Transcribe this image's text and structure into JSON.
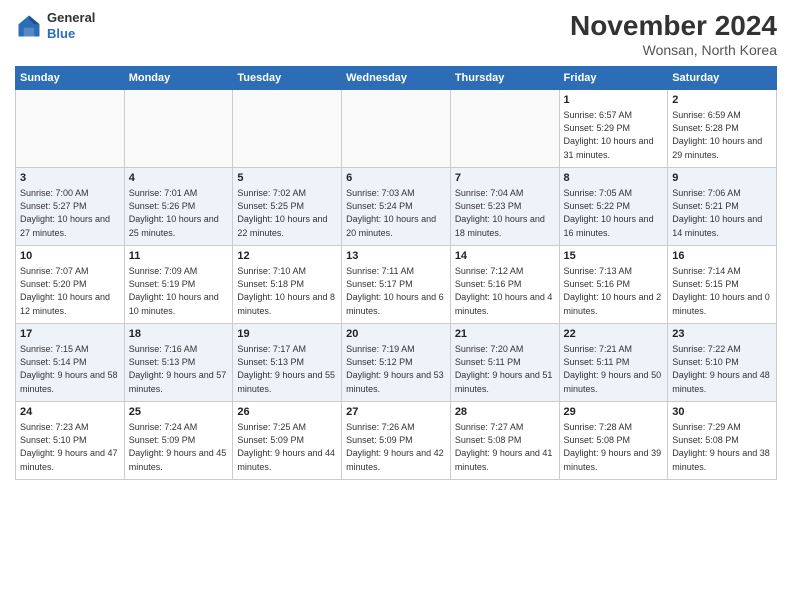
{
  "logo": {
    "line1": "General",
    "line2": "Blue"
  },
  "title": "November 2024",
  "location": "Wonsan, North Korea",
  "days_header": [
    "Sunday",
    "Monday",
    "Tuesday",
    "Wednesday",
    "Thursday",
    "Friday",
    "Saturday"
  ],
  "weeks": [
    [
      {
        "day": "",
        "info": ""
      },
      {
        "day": "",
        "info": ""
      },
      {
        "day": "",
        "info": ""
      },
      {
        "day": "",
        "info": ""
      },
      {
        "day": "",
        "info": ""
      },
      {
        "day": "1",
        "info": "Sunrise: 6:57 AM\nSunset: 5:29 PM\nDaylight: 10 hours and 31 minutes."
      },
      {
        "day": "2",
        "info": "Sunrise: 6:59 AM\nSunset: 5:28 PM\nDaylight: 10 hours and 29 minutes."
      }
    ],
    [
      {
        "day": "3",
        "info": "Sunrise: 7:00 AM\nSunset: 5:27 PM\nDaylight: 10 hours and 27 minutes."
      },
      {
        "day": "4",
        "info": "Sunrise: 7:01 AM\nSunset: 5:26 PM\nDaylight: 10 hours and 25 minutes."
      },
      {
        "day": "5",
        "info": "Sunrise: 7:02 AM\nSunset: 5:25 PM\nDaylight: 10 hours and 22 minutes."
      },
      {
        "day": "6",
        "info": "Sunrise: 7:03 AM\nSunset: 5:24 PM\nDaylight: 10 hours and 20 minutes."
      },
      {
        "day": "7",
        "info": "Sunrise: 7:04 AM\nSunset: 5:23 PM\nDaylight: 10 hours and 18 minutes."
      },
      {
        "day": "8",
        "info": "Sunrise: 7:05 AM\nSunset: 5:22 PM\nDaylight: 10 hours and 16 minutes."
      },
      {
        "day": "9",
        "info": "Sunrise: 7:06 AM\nSunset: 5:21 PM\nDaylight: 10 hours and 14 minutes."
      }
    ],
    [
      {
        "day": "10",
        "info": "Sunrise: 7:07 AM\nSunset: 5:20 PM\nDaylight: 10 hours and 12 minutes."
      },
      {
        "day": "11",
        "info": "Sunrise: 7:09 AM\nSunset: 5:19 PM\nDaylight: 10 hours and 10 minutes."
      },
      {
        "day": "12",
        "info": "Sunrise: 7:10 AM\nSunset: 5:18 PM\nDaylight: 10 hours and 8 minutes."
      },
      {
        "day": "13",
        "info": "Sunrise: 7:11 AM\nSunset: 5:17 PM\nDaylight: 10 hours and 6 minutes."
      },
      {
        "day": "14",
        "info": "Sunrise: 7:12 AM\nSunset: 5:16 PM\nDaylight: 10 hours and 4 minutes."
      },
      {
        "day": "15",
        "info": "Sunrise: 7:13 AM\nSunset: 5:16 PM\nDaylight: 10 hours and 2 minutes."
      },
      {
        "day": "16",
        "info": "Sunrise: 7:14 AM\nSunset: 5:15 PM\nDaylight: 10 hours and 0 minutes."
      }
    ],
    [
      {
        "day": "17",
        "info": "Sunrise: 7:15 AM\nSunset: 5:14 PM\nDaylight: 9 hours and 58 minutes."
      },
      {
        "day": "18",
        "info": "Sunrise: 7:16 AM\nSunset: 5:13 PM\nDaylight: 9 hours and 57 minutes."
      },
      {
        "day": "19",
        "info": "Sunrise: 7:17 AM\nSunset: 5:13 PM\nDaylight: 9 hours and 55 minutes."
      },
      {
        "day": "20",
        "info": "Sunrise: 7:19 AM\nSunset: 5:12 PM\nDaylight: 9 hours and 53 minutes."
      },
      {
        "day": "21",
        "info": "Sunrise: 7:20 AM\nSunset: 5:11 PM\nDaylight: 9 hours and 51 minutes."
      },
      {
        "day": "22",
        "info": "Sunrise: 7:21 AM\nSunset: 5:11 PM\nDaylight: 9 hours and 50 minutes."
      },
      {
        "day": "23",
        "info": "Sunrise: 7:22 AM\nSunset: 5:10 PM\nDaylight: 9 hours and 48 minutes."
      }
    ],
    [
      {
        "day": "24",
        "info": "Sunrise: 7:23 AM\nSunset: 5:10 PM\nDaylight: 9 hours and 47 minutes."
      },
      {
        "day": "25",
        "info": "Sunrise: 7:24 AM\nSunset: 5:09 PM\nDaylight: 9 hours and 45 minutes."
      },
      {
        "day": "26",
        "info": "Sunrise: 7:25 AM\nSunset: 5:09 PM\nDaylight: 9 hours and 44 minutes."
      },
      {
        "day": "27",
        "info": "Sunrise: 7:26 AM\nSunset: 5:09 PM\nDaylight: 9 hours and 42 minutes."
      },
      {
        "day": "28",
        "info": "Sunrise: 7:27 AM\nSunset: 5:08 PM\nDaylight: 9 hours and 41 minutes."
      },
      {
        "day": "29",
        "info": "Sunrise: 7:28 AM\nSunset: 5:08 PM\nDaylight: 9 hours and 39 minutes."
      },
      {
        "day": "30",
        "info": "Sunrise: 7:29 AM\nSunset: 5:08 PM\nDaylight: 9 hours and 38 minutes."
      }
    ]
  ]
}
